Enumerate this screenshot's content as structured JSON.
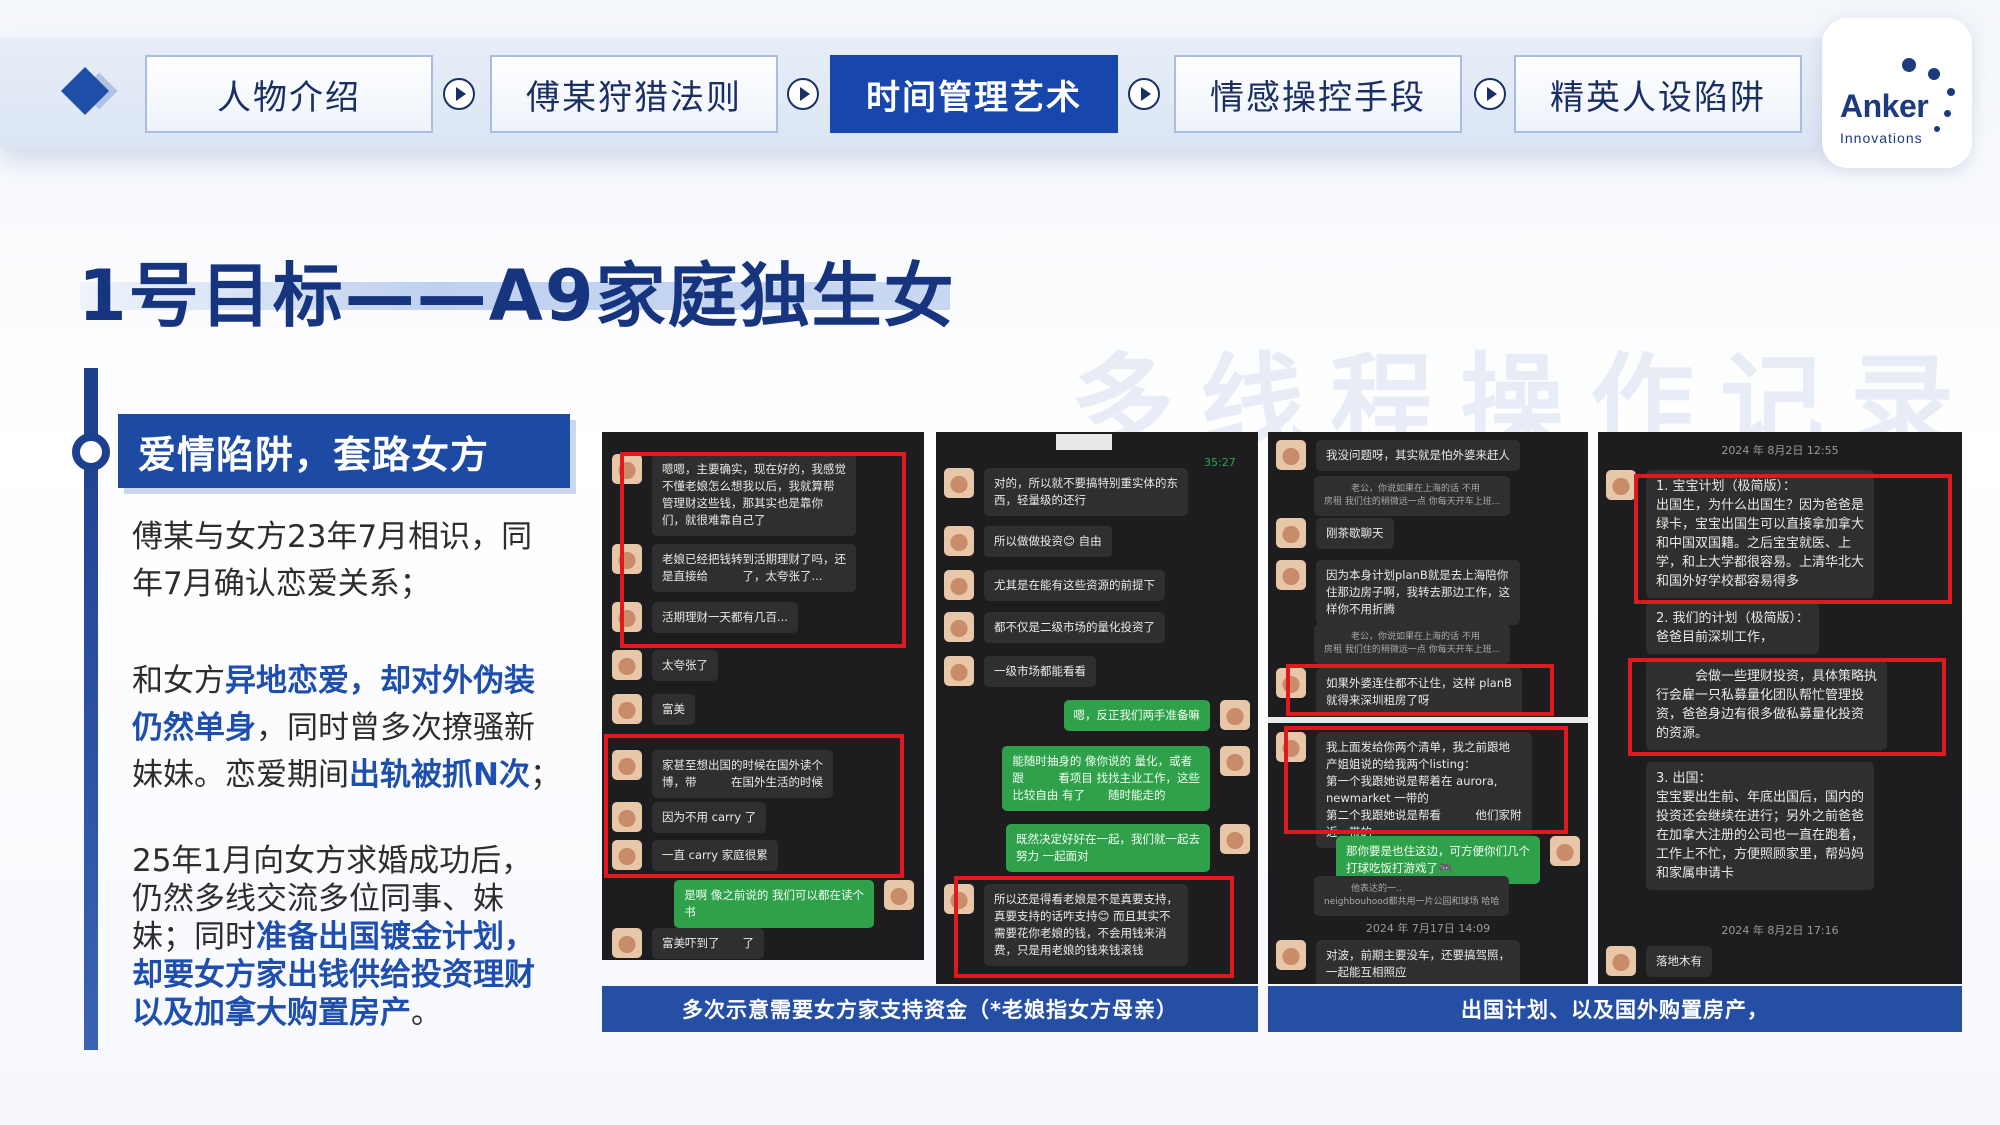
{
  "nav": {
    "tabs": [
      {
        "label": "人物介绍",
        "active": false
      },
      {
        "label": "傅某狩猎法则",
        "active": false
      },
      {
        "label": "时间管理艺术",
        "active": true
      },
      {
        "label": "情感操控手段",
        "active": false
      },
      {
        "label": "精英人设陷阱",
        "active": false
      }
    ],
    "logo": {
      "brand": "Anker",
      "sub": "Innovations"
    }
  },
  "title": "1号目标——A9家庭独生女",
  "watermark": "多线程操作记录",
  "section": {
    "header": "爱情陷阱，套路女方",
    "para1": "傅某与女方23年7月相识，同年7月确认恋爱关系；",
    "para2": {
      "a": "和女方",
      "b": "异地恋爱，却对外伪装仍然单身",
      "c": "，同时曾多次撩骚新妹妹。恋爱期间",
      "d": "出轨被抓N次",
      "e": "；"
    },
    "para3": {
      "a": "25年1月向女方求婚成功后，仍然多线交流多位同事、妹妹；同时",
      "b": "准备出国镀金计划，却要女方家出钱供给投资理财以及加拿大购置房产",
      "c": "。"
    }
  },
  "captions": {
    "left": "多次示意需要女方家支持资金（*老娘指女方母亲）",
    "right": "出国计划、以及国外购置房产，"
  },
  "shots": {
    "s1": [
      "嗯嗯，主要确实，现在好的，我感觉\n不懂老娘怎么想我以后，我就算帮\n管理财这些钱，那其实也是靠你\n们，就很难靠自己了",
      "老娘已经把钱转到活期理财了吗，还\n是直接给　　　了，太夸张了...",
      "活期理财一天都有几百...",
      "太夸张了",
      "富美",
      "家甚至想出国的时候在国外读个\n博，带　　　在国外生活的时候",
      "因为不用 carry 了",
      "一直 carry 家庭很累",
      "是啊 像之前说的 我们可以都在读个\n书",
      "富美吓到了　　了"
    ],
    "s2": [
      "35:27",
      "对的，所以就不要搞特别重实体的东\n西，轻量级的还行",
      "所以做做投资😊 自由",
      "尤其是在能有这些资源的前提下",
      "都不仅是二级市场的量化投资了",
      "一级市场都能看看",
      "嗯，反正我们两手准备嘛",
      "能随时抽身的 像你说的 量化，或者\n跟　　　看项目 找找主业工作，这些\n比较自由 有了　　随时能走的",
      "既然决定好好在一起，我们就一起去\n努力 一起面对",
      "所以还是得看老娘是不是真要支持，\n真要支持的话咋支持😊 而且其实不\n需要花你老娘的钱，不会用钱来消\n费，只是用老娘的钱来钱滚钱"
    ],
    "s3": [
      "我没问题呀，其实就是怕外婆来赶人",
      "　　　老公，你说如果在上海的话 不用\n房租 我们住的稍微远一点 你每天开车上班...",
      "刚茶歇聊天",
      "因为本身计划planB就是去上海陪你\n住那边房子啊，我转去那边工作，这\n样你不用折腾",
      "　　　老公，你说如果在上海的话 不用\n房租 我们住的稍微远一点 你每天开车上班...",
      "如果外婆连住都不让住，这样 planB\n就得来深圳租房了呀",
      "我上面发给你两个清单，我之前跟地\n产姐姐说的给我两个listing：\n第一个我跟她说是帮着在 aurora,\nnewmarket 一带的\n第二个我跟她说是帮看　　　他们家附\n近一带的",
      "那你要是也住这边，可方便你们几个\n打球吃饭打游戏了🎮",
      "　　　他表达的一..\nneighbouhood都共用一片公园和球场 哈哈",
      "2024 年 7月17日 14:09",
      "对波，前期主要没车，还要搞驾照，\n一起能互相照应"
    ],
    "s4": [
      "2024 年 8月2日 12:55",
      "1. 宝宝计划（极简版）：\n出国生，为什么出国生？因为爸爸是\n绿卡，宝宝出国生可以直接拿加拿大\n和中国双国籍。之后宝宝就医、上\n学，和上大学都很容易。上清华北大\n和国外好学校都容易得多",
      "2. 我们的计划（极简版）：\n爸爸目前深圳工作，",
      "　　　会做一些理财投资，具体策略执\n行会雇一只私募量化团队帮忙管理投\n资，爸爸身边有很多做私募量化投资\n的资源。",
      "3. 出国：\n宝宝要出生前、年底出国后，国内的\n投资还会继续在进行；另外之前爸爸\n在加拿大注册的公司也一直在跑着，\n工作上不忙，方便照顾家里，帮妈妈\n和家属申请卡",
      "2024 年 8月2日 17:16",
      "落地木有"
    ]
  },
  "colors": {
    "primary": "#1d4aa3",
    "highlight_text": "#1f4fae",
    "red_box": "#e0191d",
    "chat_green": "#2ea14a"
  }
}
